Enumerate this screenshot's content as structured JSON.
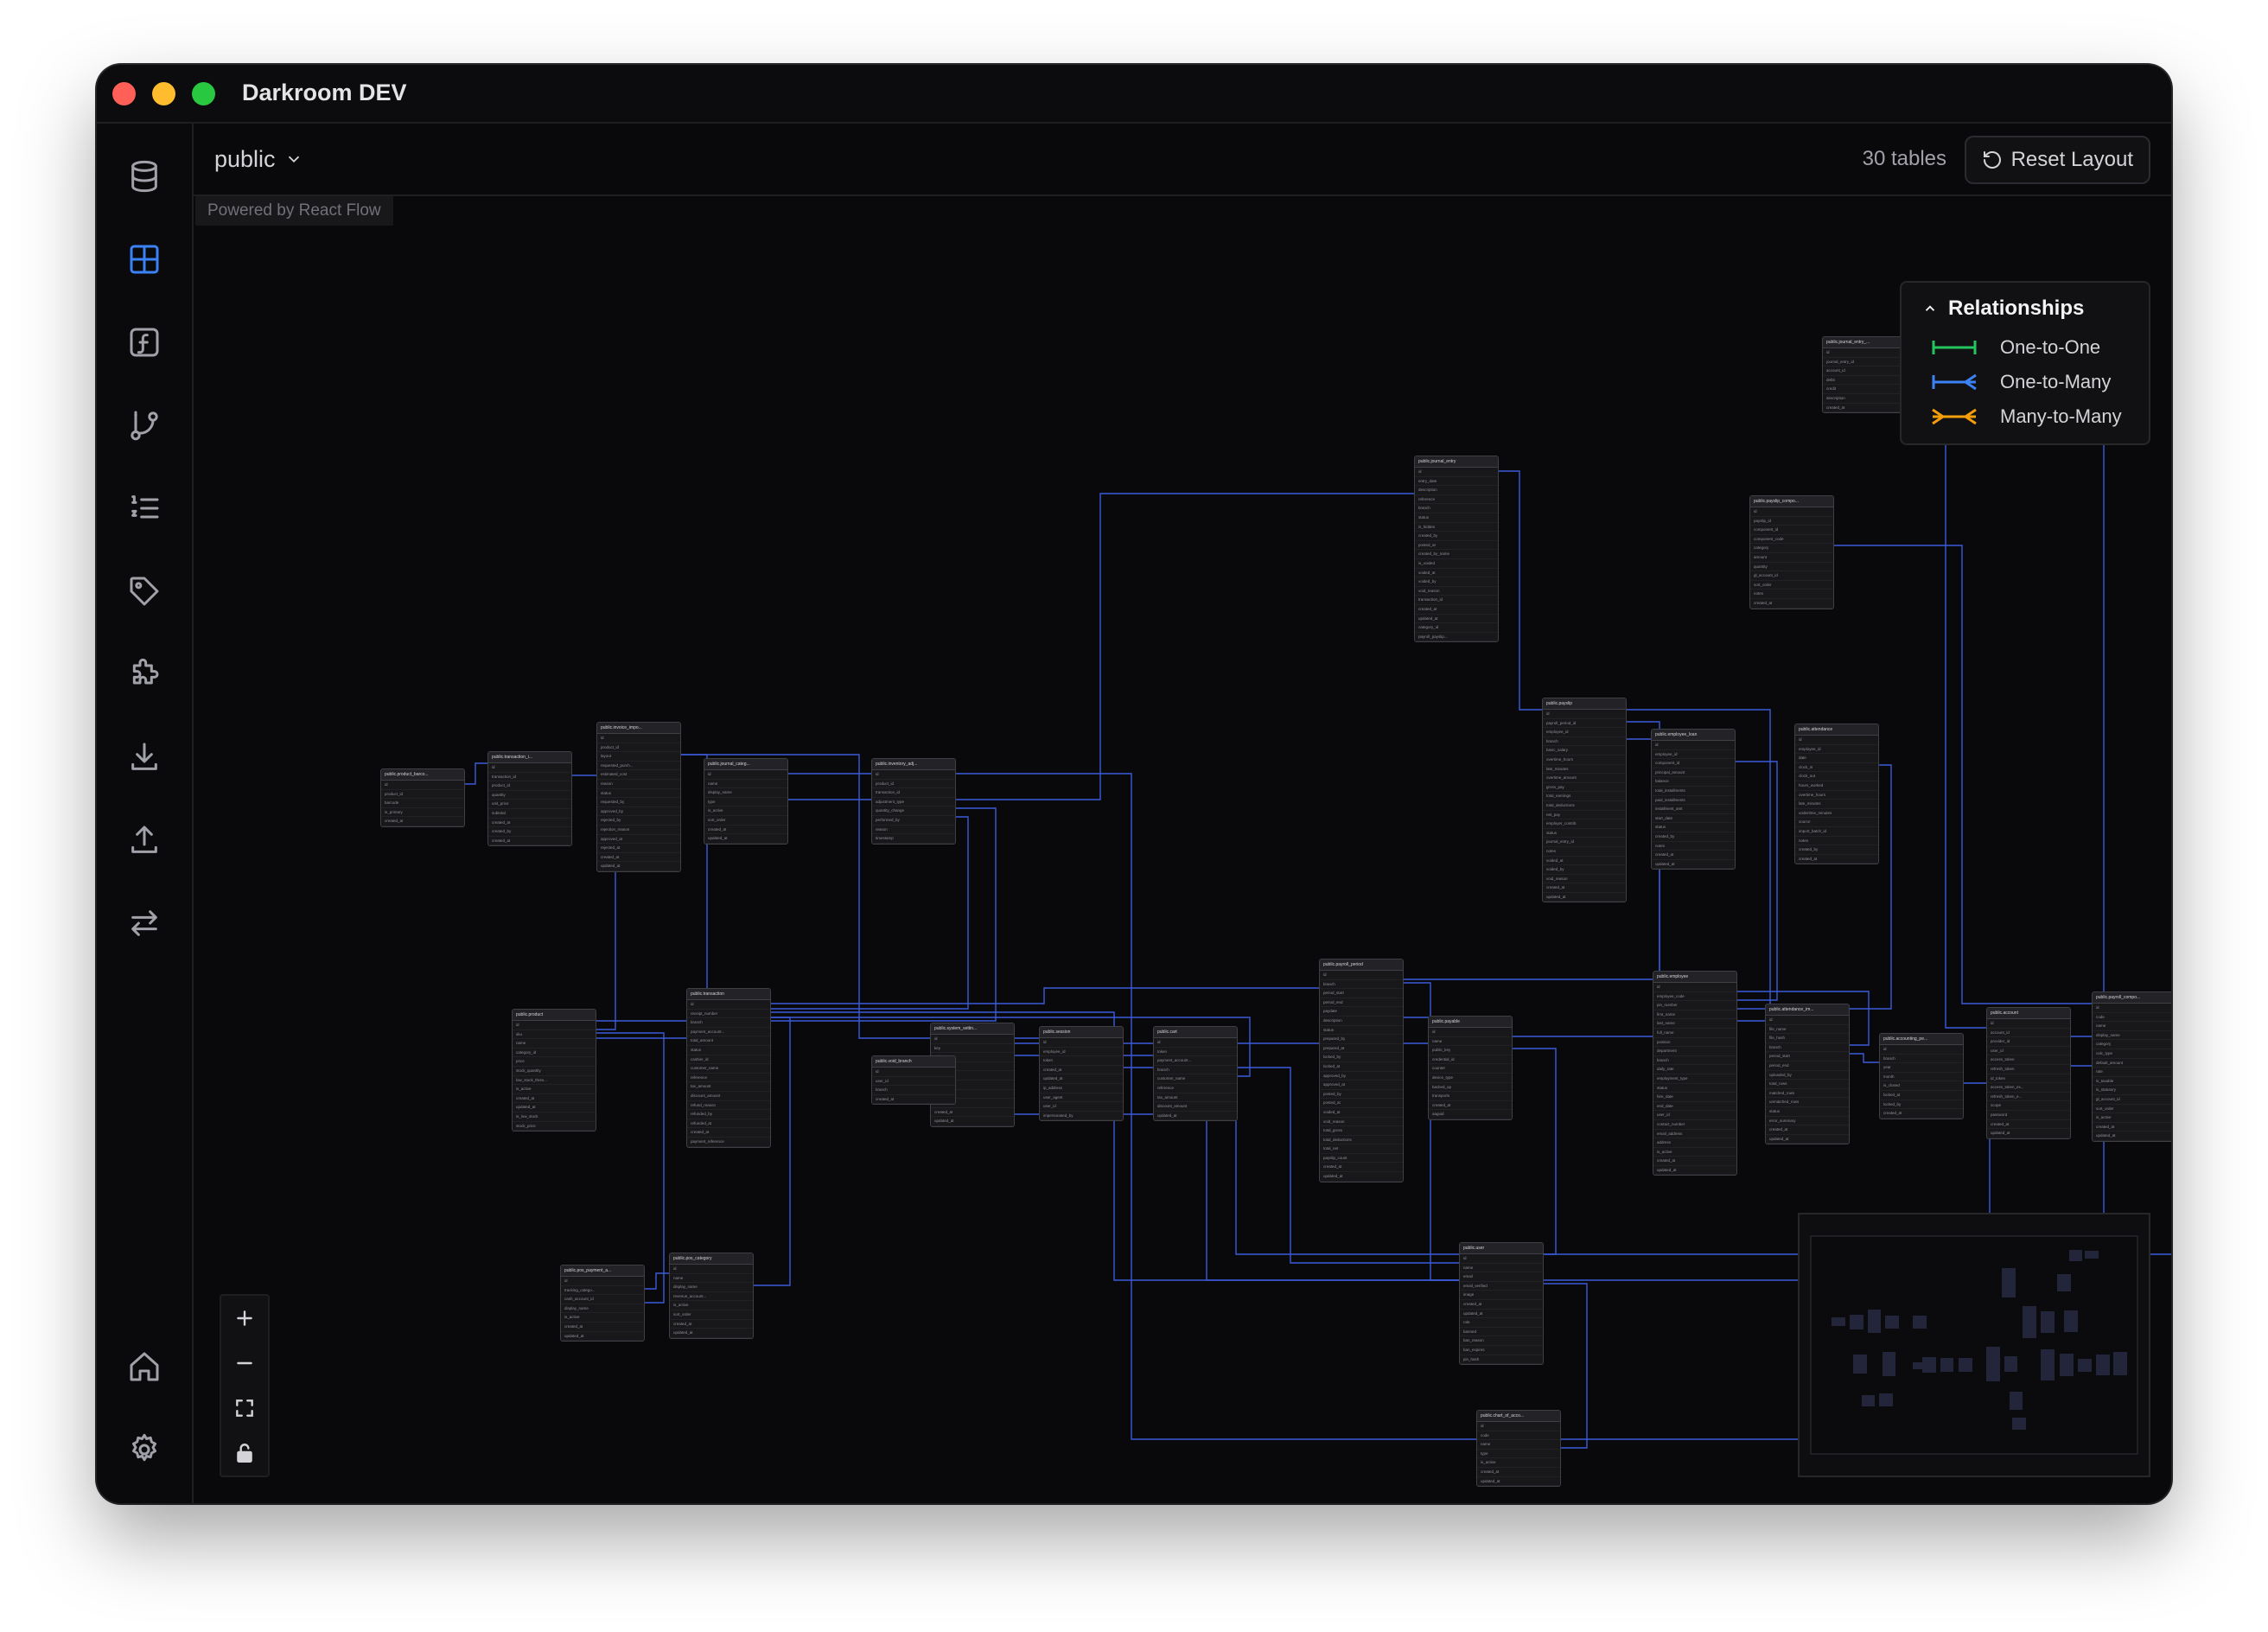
{
  "window": {
    "title": "Darkroom DEV"
  },
  "topbar": {
    "schema": "public",
    "table_count": "30 tables",
    "reset_label": "Reset Layout"
  },
  "attribution": "Powered by React Flow",
  "sidebar": {
    "items": [
      {
        "icon": "database-icon"
      },
      {
        "icon": "grid-icon",
        "active": true
      },
      {
        "icon": "function-icon"
      },
      {
        "icon": "git-branch-icon"
      },
      {
        "icon": "ordered-list-icon"
      },
      {
        "icon": "tag-icon"
      },
      {
        "icon": "puzzle-icon"
      },
      {
        "icon": "download-icon"
      },
      {
        "icon": "upload-icon"
      },
      {
        "icon": "transfer-icon"
      }
    ],
    "bottom": [
      {
        "icon": "home-icon"
      },
      {
        "icon": "settings-icon"
      }
    ]
  },
  "legend": {
    "title": "Relationships",
    "items": [
      {
        "label": "One-to-One",
        "color": "#22c55e"
      },
      {
        "label": "One-to-Many",
        "color": "#3b82f6"
      },
      {
        "label": "Many-to-Many",
        "color": "#f59e0b"
      }
    ]
  },
  "edge_color": "#3b5bd9",
  "tables": [
    {
      "name": "public.journal_entry_...",
      "rows": [
        "id",
        "journal_entry_id",
        "account_id",
        "debit",
        "credit",
        "description",
        "created_at"
      ]
    },
    {
      "name": "public.zone",
      "rows": [
        "id",
        "public_key",
        "created_at",
        "expires_at"
      ]
    },
    {
      "name": "public.journal_entry",
      "rows": [
        "id",
        "entry_date",
        "description",
        "reference",
        "branch",
        "status",
        "is_hidden",
        "created_by",
        "posted_at",
        "created_by_name",
        "is_voided",
        "voided_at",
        "voided_by",
        "void_reason",
        "transaction_id",
        "created_at",
        "updated_at",
        "category_id",
        "payroll_payslip..."
      ]
    },
    {
      "name": "public.payslip_compo...",
      "rows": [
        "id",
        "payslip_id",
        "component_id",
        "component_code",
        "category",
        "amount",
        "quantity",
        "gl_account_id",
        "sort_order",
        "notes",
        "created_at"
      ]
    },
    {
      "name": "public.payslip",
      "rows": [
        "id",
        "payroll_period_id",
        "employee_id",
        "branch",
        "basic_salary",
        "overtime_hours",
        "late_minutes",
        "overtime_amount",
        "gross_pay",
        "total_earnings",
        "total_deductions",
        "net_pay",
        "employer_contrib",
        "status",
        "journal_entry_id",
        "notes",
        "voided_at",
        "voided_by",
        "void_reason",
        "created_at",
        "updated_at"
      ]
    },
    {
      "name": "public.employee_loan",
      "rows": [
        "id",
        "employee_id",
        "component_id",
        "principal_amount",
        "balance",
        "total_installments",
        "paid_installments",
        "installment_amt",
        "start_date",
        "status",
        "created_by",
        "notes",
        "created_at",
        "updated_at"
      ]
    },
    {
      "name": "public.attendance",
      "rows": [
        "id",
        "employee_id",
        "date",
        "clock_in",
        "clock_out",
        "hours_worked",
        "overtime_hours",
        "late_minutes",
        "undertime_minutes",
        "source",
        "import_batch_id",
        "notes",
        "created_by",
        "created_at"
      ]
    },
    {
      "name": "public.product_barco...",
      "rows": [
        "id",
        "product_id",
        "barcode",
        "is_primary",
        "created_at"
      ]
    },
    {
      "name": "public.transaction_i...",
      "rows": [
        "id",
        "transaction_id",
        "product_id",
        "quantity",
        "unit_price",
        "subtotal",
        "created_at",
        "created_by",
        "created_at"
      ]
    },
    {
      "name": "public.invoice_impo...",
      "rows": [
        "id",
        "product_id",
        "layout",
        "requested_purch...",
        "estimated_cost",
        "reason",
        "status",
        "requested_by",
        "approved_by",
        "rejected_by",
        "rejection_reason",
        "approved_at",
        "rejected_at",
        "created_at",
        "updated_at"
      ]
    },
    {
      "name": "public.journal_categ...",
      "rows": [
        "id",
        "name",
        "display_name",
        "type",
        "is_active",
        "sort_order",
        "created_at",
        "updated_at"
      ]
    },
    {
      "name": "public.inventory_adj...",
      "rows": [
        "id",
        "product_id",
        "transaction_id",
        "adjustment_type",
        "quantity_change",
        "performed_by",
        "reason",
        "timestamp"
      ]
    },
    {
      "name": "public.payroll_period",
      "rows": [
        "id",
        "branch",
        "period_start",
        "period_end",
        "paydate",
        "description",
        "status",
        "prepared_by",
        "prepared_at",
        "locked_by",
        "locked_at",
        "approved_by",
        "approved_at",
        "posted_by",
        "posted_at",
        "voided_at",
        "void_reason",
        "total_gross",
        "total_deductions",
        "total_net",
        "payslip_count",
        "created_at",
        "updated_at"
      ]
    },
    {
      "name": "public.employee",
      "rows": [
        "id",
        "employee_code",
        "pin_number",
        "first_name",
        "last_name",
        "full_name",
        "position",
        "department",
        "branch",
        "daily_rate",
        "employment_type",
        "status",
        "hire_date",
        "end_date",
        "user_id",
        "contact_number",
        "email_address",
        "address",
        "is_active",
        "created_at",
        "updated_at"
      ]
    },
    {
      "name": "public.product",
      "rows": [
        "id",
        "sku",
        "name",
        "category_id",
        "price",
        "stock_quantity",
        "low_stock_thres...",
        "is_active",
        "created_at",
        "updated_at",
        "is_low_stock",
        "stock_price"
      ]
    },
    {
      "name": "public.transaction",
      "rows": [
        "id",
        "receipt_number",
        "branch",
        "payment_account...",
        "total_amount",
        "status",
        "cashier_id",
        "customer_name",
        "reference",
        "tax_amount",
        "discount_amount",
        "refund_reason",
        "refunded_by",
        "refunded_at",
        "created_at",
        "payment_reference"
      ]
    },
    {
      "name": "public.system_settin...",
      "rows": [
        "id",
        "key",
        "value",
        "value_type",
        "category",
        "label",
        "description",
        "updated_by",
        "created_at",
        "updated_at"
      ]
    },
    {
      "name": "public.session",
      "rows": [
        "id",
        "employee_id",
        "token",
        "created_at",
        "updated_at",
        "ip_address",
        "user_agent",
        "user_id",
        "impersonated_by"
      ]
    },
    {
      "name": "public.cart",
      "rows": [
        "id",
        "token",
        "payment_account...",
        "branch",
        "customer_name",
        "reference",
        "tax_amount",
        "discount_amount",
        "updated_at"
      ]
    },
    {
      "name": "public.void_branch",
      "rows": [
        "id",
        "user_id",
        "branch",
        "created_at"
      ]
    },
    {
      "name": "public.payable",
      "rows": [
        "id",
        "name",
        "public_key",
        "credential_id",
        "counter",
        "device_type",
        "backed_up",
        "transports",
        "created_at",
        "aaguid"
      ]
    },
    {
      "name": "public.attendance_im...",
      "rows": [
        "id",
        "file_name",
        "file_hash",
        "branch",
        "period_start",
        "period_end",
        "uploaded_by",
        "total_rows",
        "matched_rows",
        "unmatched_rows",
        "status",
        "error_summary",
        "created_at",
        "updated_at"
      ]
    },
    {
      "name": "public.accounting_pe...",
      "rows": [
        "id",
        "branch",
        "year",
        "month",
        "is_closed",
        "locked_at",
        "locked_by",
        "created_at"
      ]
    },
    {
      "name": "public.account",
      "rows": [
        "id",
        "account_id",
        "provider_id",
        "user_id",
        "access_token",
        "refresh_token",
        "id_token",
        "access_token_ex...",
        "refresh_token_e...",
        "scope",
        "password",
        "created_at",
        "updated_at"
      ]
    },
    {
      "name": "public.payroll_compo...",
      "rows": [
        "id",
        "code",
        "name",
        "display_name",
        "category",
        "calc_type",
        "default_amount",
        "rate",
        "is_taxable",
        "is_statutory",
        "gl_account_id",
        "sort_order",
        "is_active",
        "created_at",
        "updated_at"
      ]
    },
    {
      "name": "public.pos_payment_a...",
      "rows": [
        "id",
        "tracking_catego...",
        "cash_account_id",
        "display_name",
        "is_active",
        "created_at",
        "updated_at"
      ]
    },
    {
      "name": "public.pos_category",
      "rows": [
        "id",
        "name",
        "display_name",
        "revenue_account...",
        "is_active",
        "sort_order",
        "created_at",
        "updated_at"
      ]
    },
    {
      "name": "public.user",
      "rows": [
        "id",
        "name",
        "email",
        "email_verified",
        "image",
        "created_at",
        "updated_at",
        "role",
        "banned",
        "ban_reason",
        "ban_expires",
        "pin_hash"
      ]
    },
    {
      "name": "public.chart_of_acco...",
      "rows": [
        "id",
        "code",
        "name",
        "type",
        "is_active",
        "created_at",
        "updated_at"
      ]
    }
  ]
}
